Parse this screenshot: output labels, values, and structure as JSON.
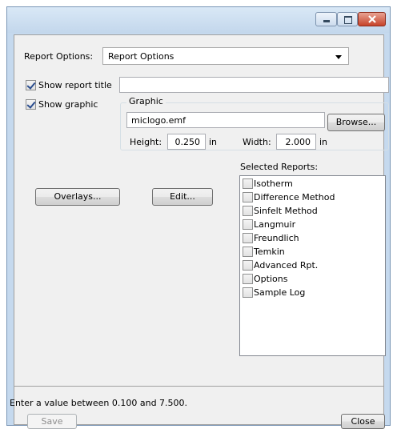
{
  "report_options": {
    "label": "Report Options:",
    "selected": "Report Options"
  },
  "show_report_title": {
    "label": "Show report title",
    "checked": true,
    "value": ""
  },
  "show_graphic": {
    "label": "Show graphic",
    "checked": true
  },
  "graphic": {
    "group_label": "Graphic",
    "filename": "miclogo.emf",
    "browse_label": "Browse...",
    "height_label": "Height:",
    "height_value": "0.250",
    "height_unit": "in",
    "width_label": "Width:",
    "width_value": "2.000",
    "width_unit": "in"
  },
  "buttons": {
    "overlays": "Overlays...",
    "edit": "Edit...",
    "save": "Save",
    "close": "Close"
  },
  "selected_reports": {
    "label": "Selected Reports:",
    "items": [
      {
        "label": "Isotherm",
        "checked": false
      },
      {
        "label": "Difference Method",
        "checked": false
      },
      {
        "label": "Sinfelt Method",
        "checked": false
      },
      {
        "label": "Langmuir",
        "checked": false
      },
      {
        "label": "Freundlich",
        "checked": false
      },
      {
        "label": "Temkin",
        "checked": false
      },
      {
        "label": "Advanced Rpt.",
        "checked": false
      },
      {
        "label": "Options",
        "checked": false
      },
      {
        "label": "Sample Log",
        "checked": false
      }
    ]
  },
  "status": "Enter a value between 0.100 and 7.500.",
  "icons": [
    "minimize-icon",
    "maximize-icon",
    "close-icon",
    "dropdown-arrow-icon",
    "checkbox-checked-icon",
    "checkbox-unchecked-icon"
  ]
}
